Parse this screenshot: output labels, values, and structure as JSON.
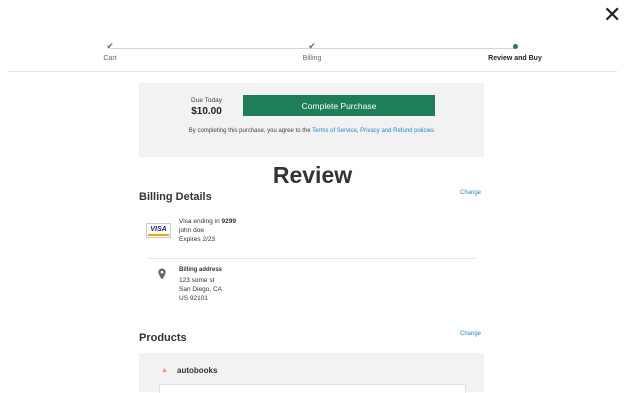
{
  "header": {
    "close_icon": "close-icon",
    "close_glyph": "✕"
  },
  "stepper": {
    "steps": [
      {
        "label": "Cart",
        "state": "complete",
        "mark": "✔"
      },
      {
        "label": "Billing",
        "state": "complete",
        "mark": "✔"
      },
      {
        "label": "Review and Buy",
        "state": "active"
      }
    ],
    "accent_color": "#1e7e5a"
  },
  "purchase": {
    "due_label": "Due Today",
    "due_amount": "$10.00",
    "button_label": "Complete Purchase",
    "terms_prefix": "By completing this purchase, you agree to the",
    "terms_link": "Terms of Service",
    "terms_sep": ",",
    "privacy_link": "Privacy and Refund policies"
  },
  "page_title": "Review",
  "billing": {
    "title": "Billing Details",
    "change_label": "Change",
    "card": {
      "brand": "VISA",
      "ending_prefix": "Visa ending in",
      "last4": "9299",
      "name": "john doe",
      "expires": "Expires 2/23"
    },
    "address": {
      "heading": "Billing address",
      "line1": "123 some st",
      "line2": "San Diego, CA",
      "line3": "US 92101"
    }
  },
  "products": {
    "title": "Products",
    "change_label": "Change",
    "items": [
      {
        "name": "autobooks",
        "toggle": "▲"
      }
    ]
  }
}
